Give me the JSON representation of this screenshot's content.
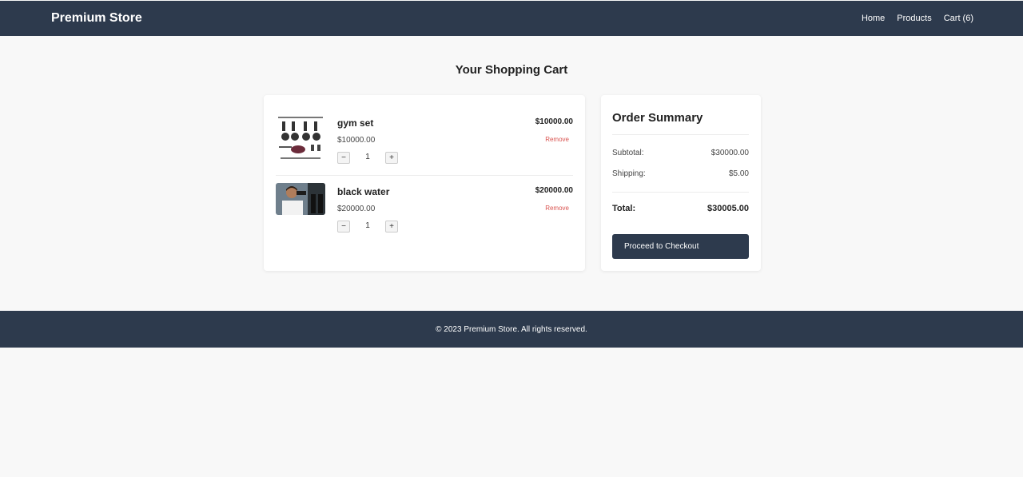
{
  "header": {
    "brand": "Premium Store",
    "nav": [
      "Home",
      "Products",
      "Cart (6)"
    ]
  },
  "page_title": "Your Shopping Cart",
  "cart": {
    "items": [
      {
        "name": "gym set",
        "price": "$10000.00",
        "quantity": "1",
        "total": "$10000.00",
        "remove_label": "Remove",
        "minus": "−",
        "plus": "+"
      },
      {
        "name": "black water",
        "price": "$20000.00",
        "quantity": "1",
        "total": "$20000.00",
        "remove_label": "Remove",
        "minus": "−",
        "plus": "+"
      }
    ]
  },
  "summary": {
    "title": "Order Summary",
    "subtotal_label": "Subtotal:",
    "subtotal_value": "$30000.00",
    "shipping_label": "Shipping:",
    "shipping_value": "$5.00",
    "total_label": "Total:",
    "total_value": "$30005.00",
    "checkout_label": "Proceed to Checkout"
  },
  "footer": {
    "text": "© 2023 Premium Store. All rights reserved."
  },
  "colors": {
    "header_bg": "#2d3a4d",
    "page_bg": "#f8f8f8",
    "remove": "#d9534f"
  }
}
